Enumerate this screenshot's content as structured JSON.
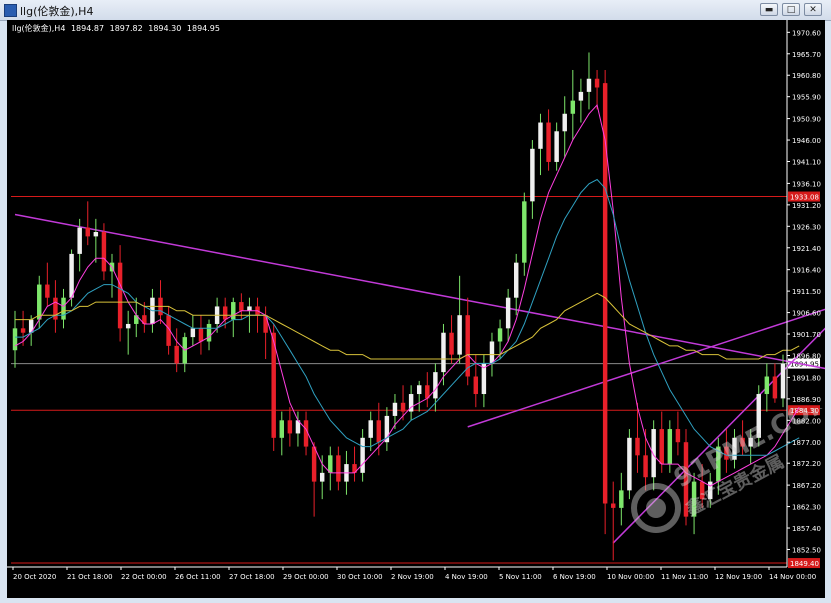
{
  "window": {
    "title": "llg(伦敦金),H4",
    "buttons": {
      "minimize": "▬",
      "maximize": "□",
      "close": "✕"
    }
  },
  "chart_data": {
    "type": "candlestick",
    "symbol_label": "llg(伦敦金),H4",
    "ohlc_header": {
      "open": "1894.87",
      "high": "1897.82",
      "low": "1894.30",
      "close": "1894.95"
    },
    "ylim": [
      1848.5,
      1972.5
    ],
    "y_ticks": [
      "1970.60",
      "1965.70",
      "1960.80",
      "1955.90",
      "1950.90",
      "1946.00",
      "1941.10",
      "1936.10",
      "1931.20",
      "1926.30",
      "1921.40",
      "1916.40",
      "1911.50",
      "1906.60",
      "1901.70",
      "1896.80",
      "1891.80",
      "1886.90",
      "1882.00",
      "1877.00",
      "1872.20",
      "1867.20",
      "1862.30",
      "1857.40",
      "1852.50"
    ],
    "x_ticks": [
      "20 Oct 2020",
      "21 Oct 18:00",
      "22 Oct 00:00",
      "26 Oct 11:00",
      "27 Oct 18:00",
      "29 Oct 00:00",
      "30 Oct 10:00",
      "2 Nov 19:00",
      "4 Nov 19:00",
      "5 Nov 11:00",
      "6 Nov 19:00",
      "10 Nov 00:00",
      "11 Nov 11:00",
      "12 Nov 19:00",
      "14 Nov 00:00"
    ],
    "current_price": "1894.95",
    "horizontal_lines": [
      {
        "value": 1933.1,
        "label": "1933.08",
        "color": "#d61a1a"
      },
      {
        "value": 1884.3,
        "label": "1884.30",
        "color": "#d61a1a"
      },
      {
        "value": 1849.4,
        "label": "1849.40",
        "color": "#d61a1a"
      }
    ],
    "bull_color": "#f0f0f0",
    "bull_color_alt": "#7ee66b",
    "bear_color": "#e8202a",
    "candles": [
      {
        "o": 1898,
        "h": 1907,
        "l": 1894,
        "c": 1903
      },
      {
        "o": 1903,
        "h": 1907,
        "l": 1899,
        "c": 1902
      },
      {
        "o": 1902,
        "h": 1906,
        "l": 1899,
        "c": 1905
      },
      {
        "o": 1905,
        "h": 1915,
        "l": 1903,
        "c": 1913
      },
      {
        "o": 1913,
        "h": 1918,
        "l": 1908,
        "c": 1910
      },
      {
        "o": 1910,
        "h": 1914,
        "l": 1902,
        "c": 1905
      },
      {
        "o": 1905,
        "h": 1912,
        "l": 1903,
        "c": 1910
      },
      {
        "o": 1910,
        "h": 1921,
        "l": 1908,
        "c": 1920
      },
      {
        "o": 1920,
        "h": 1928,
        "l": 1916,
        "c": 1926
      },
      {
        "o": 1926,
        "h": 1932,
        "l": 1922,
        "c": 1924
      },
      {
        "o": 1924,
        "h": 1928,
        "l": 1918,
        "c": 1925
      },
      {
        "o": 1925,
        "h": 1927,
        "l": 1914,
        "c": 1916
      },
      {
        "o": 1916,
        "h": 1920,
        "l": 1910,
        "c": 1918
      },
      {
        "o": 1918,
        "h": 1922,
        "l": 1900,
        "c": 1903
      },
      {
        "o": 1903,
        "h": 1907,
        "l": 1897,
        "c": 1904
      },
      {
        "o": 1904,
        "h": 1910,
        "l": 1901,
        "c": 1906
      },
      {
        "o": 1906,
        "h": 1909,
        "l": 1902,
        "c": 1904
      },
      {
        "o": 1904,
        "h": 1912,
        "l": 1902,
        "c": 1910
      },
      {
        "o": 1910,
        "h": 1914,
        "l": 1904,
        "c": 1906
      },
      {
        "o": 1906,
        "h": 1908,
        "l": 1897,
        "c": 1899
      },
      {
        "o": 1899,
        "h": 1903,
        "l": 1893,
        "c": 1895
      },
      {
        "o": 1895,
        "h": 1902,
        "l": 1893,
        "c": 1901
      },
      {
        "o": 1901,
        "h": 1906,
        "l": 1899,
        "c": 1903
      },
      {
        "o": 1903,
        "h": 1906,
        "l": 1897,
        "c": 1900
      },
      {
        "o": 1900,
        "h": 1905,
        "l": 1898,
        "c": 1904
      },
      {
        "o": 1904,
        "h": 1910,
        "l": 1902,
        "c": 1908
      },
      {
        "o": 1908,
        "h": 1910,
        "l": 1903,
        "c": 1905
      },
      {
        "o": 1905,
        "h": 1910,
        "l": 1901,
        "c": 1909
      },
      {
        "o": 1909,
        "h": 1911,
        "l": 1905,
        "c": 1907
      },
      {
        "o": 1907,
        "h": 1910,
        "l": 1902,
        "c": 1908
      },
      {
        "o": 1908,
        "h": 1910,
        "l": 1902,
        "c": 1906
      },
      {
        "o": 1906,
        "h": 1908,
        "l": 1896,
        "c": 1902
      },
      {
        "o": 1902,
        "h": 1904,
        "l": 1875,
        "c": 1878
      },
      {
        "o": 1878,
        "h": 1884,
        "l": 1874,
        "c": 1882
      },
      {
        "o": 1882,
        "h": 1885,
        "l": 1876,
        "c": 1879
      },
      {
        "o": 1879,
        "h": 1884,
        "l": 1876,
        "c": 1882
      },
      {
        "o": 1882,
        "h": 1884,
        "l": 1874,
        "c": 1876
      },
      {
        "o": 1876,
        "h": 1877,
        "l": 1860,
        "c": 1868
      },
      {
        "o": 1868,
        "h": 1874,
        "l": 1864,
        "c": 1870
      },
      {
        "o": 1870,
        "h": 1876,
        "l": 1866,
        "c": 1874
      },
      {
        "o": 1874,
        "h": 1876,
        "l": 1866,
        "c": 1868
      },
      {
        "o": 1868,
        "h": 1875,
        "l": 1865,
        "c": 1872
      },
      {
        "o": 1872,
        "h": 1876,
        "l": 1868,
        "c": 1870
      },
      {
        "o": 1870,
        "h": 1880,
        "l": 1868,
        "c": 1878
      },
      {
        "o": 1878,
        "h": 1884,
        "l": 1875,
        "c": 1882
      },
      {
        "o": 1882,
        "h": 1886,
        "l": 1874,
        "c": 1877
      },
      {
        "o": 1877,
        "h": 1885,
        "l": 1875,
        "c": 1883
      },
      {
        "o": 1883,
        "h": 1888,
        "l": 1880,
        "c": 1886
      },
      {
        "o": 1886,
        "h": 1890,
        "l": 1882,
        "c": 1884
      },
      {
        "o": 1884,
        "h": 1890,
        "l": 1882,
        "c": 1888
      },
      {
        "o": 1888,
        "h": 1891,
        "l": 1884,
        "c": 1890
      },
      {
        "o": 1890,
        "h": 1893,
        "l": 1885,
        "c": 1887
      },
      {
        "o": 1887,
        "h": 1895,
        "l": 1884,
        "c": 1893
      },
      {
        "o": 1893,
        "h": 1904,
        "l": 1890,
        "c": 1902
      },
      {
        "o": 1902,
        "h": 1906,
        "l": 1895,
        "c": 1897
      },
      {
        "o": 1897,
        "h": 1915,
        "l": 1895,
        "c": 1906
      },
      {
        "o": 1906,
        "h": 1910,
        "l": 1890,
        "c": 1892
      },
      {
        "o": 1892,
        "h": 1897,
        "l": 1885,
        "c": 1888
      },
      {
        "o": 1888,
        "h": 1897,
        "l": 1885,
        "c": 1895
      },
      {
        "o": 1895,
        "h": 1902,
        "l": 1892,
        "c": 1900
      },
      {
        "o": 1900,
        "h": 1905,
        "l": 1896,
        "c": 1903
      },
      {
        "o": 1903,
        "h": 1912,
        "l": 1900,
        "c": 1910
      },
      {
        "o": 1910,
        "h": 1920,
        "l": 1906,
        "c": 1918
      },
      {
        "o": 1918,
        "h": 1934,
        "l": 1915,
        "c": 1932
      },
      {
        "o": 1932,
        "h": 1946,
        "l": 1928,
        "c": 1944
      },
      {
        "o": 1944,
        "h": 1952,
        "l": 1938,
        "c": 1950
      },
      {
        "o": 1950,
        "h": 1953,
        "l": 1939,
        "c": 1941
      },
      {
        "o": 1941,
        "h": 1950,
        "l": 1939,
        "c": 1948
      },
      {
        "o": 1948,
        "h": 1956,
        "l": 1942,
        "c": 1952
      },
      {
        "o": 1952,
        "h": 1962,
        "l": 1946,
        "c": 1955
      },
      {
        "o": 1955,
        "h": 1960,
        "l": 1950,
        "c": 1957
      },
      {
        "o": 1957,
        "h": 1966,
        "l": 1953,
        "c": 1960
      },
      {
        "o": 1960,
        "h": 1962,
        "l": 1953,
        "c": 1958
      },
      {
        "o": 1959,
        "h": 1962,
        "l": 1856,
        "c": 1863
      },
      {
        "o": 1863,
        "h": 1868,
        "l": 1850,
        "c": 1862
      },
      {
        "o": 1862,
        "h": 1870,
        "l": 1858,
        "c": 1866
      },
      {
        "o": 1866,
        "h": 1880,
        "l": 1864,
        "c": 1878
      },
      {
        "o": 1878,
        "h": 1886,
        "l": 1870,
        "c": 1874
      },
      {
        "o": 1874,
        "h": 1880,
        "l": 1866,
        "c": 1869
      },
      {
        "o": 1869,
        "h": 1882,
        "l": 1866,
        "c": 1880
      },
      {
        "o": 1880,
        "h": 1884,
        "l": 1870,
        "c": 1872
      },
      {
        "o": 1872,
        "h": 1882,
        "l": 1870,
        "c": 1880
      },
      {
        "o": 1880,
        "h": 1884,
        "l": 1874,
        "c": 1877
      },
      {
        "o": 1877,
        "h": 1880,
        "l": 1858,
        "c": 1860
      },
      {
        "o": 1860,
        "h": 1870,
        "l": 1856,
        "c": 1868
      },
      {
        "o": 1868,
        "h": 1872,
        "l": 1862,
        "c": 1864
      },
      {
        "o": 1864,
        "h": 1870,
        "l": 1862,
        "c": 1868
      },
      {
        "o": 1868,
        "h": 1878,
        "l": 1865,
        "c": 1876
      },
      {
        "o": 1876,
        "h": 1880,
        "l": 1870,
        "c": 1873
      },
      {
        "o": 1873,
        "h": 1880,
        "l": 1871,
        "c": 1878
      },
      {
        "o": 1878,
        "h": 1882,
        "l": 1874,
        "c": 1876
      },
      {
        "o": 1876,
        "h": 1880,
        "l": 1872,
        "c": 1878
      },
      {
        "o": 1878,
        "h": 1890,
        "l": 1876,
        "c": 1888
      },
      {
        "o": 1888,
        "h": 1895,
        "l": 1884,
        "c": 1892
      },
      {
        "o": 1892,
        "h": 1895,
        "l": 1886,
        "c": 1887
      },
      {
        "o": 1887,
        "h": 1897,
        "l": 1885,
        "c": 1894.95
      }
    ],
    "moving_averages": [
      {
        "name": "MA-fast",
        "color": "#ff3fe0",
        "values": [
          1899,
          1900,
          1902,
          1905,
          1908,
          1909,
          1908,
          1910,
          1914,
          1917,
          1919,
          1919,
          1917,
          1913,
          1909,
          1906,
          1904,
          1904,
          1905,
          1903,
          1900,
          1898,
          1899,
          1900,
          1901,
          1903,
          1905,
          1906,
          1907,
          1907,
          1907,
          1906,
          1900,
          1893,
          1886,
          1882,
          1880,
          1876,
          1872,
          1870,
          1870,
          1870,
          1870,
          1872,
          1874,
          1876,
          1878,
          1881,
          1883,
          1885,
          1886,
          1887,
          1889,
          1892,
          1894,
          1896,
          1897,
          1895,
          1894,
          1895,
          1897,
          1900,
          1905,
          1912,
          1920,
          1928,
          1934,
          1938,
          1942,
          1946,
          1949,
          1952,
          1954,
          1946,
          1930,
          1910,
          1895,
          1885,
          1878,
          1874,
          1872,
          1872,
          1872,
          1870,
          1869,
          1868,
          1867,
          1868,
          1869,
          1870,
          1871,
          1872,
          1873,
          1874,
          1876,
          1879,
          1882,
          1885
        ]
      },
      {
        "name": "MA-mid",
        "color": "#2fa0c0",
        "values": [
          1901,
          1901,
          1902,
          1903,
          1905,
          1906,
          1906,
          1907,
          1909,
          1911,
          1912,
          1913,
          1913,
          1912,
          1911,
          1909,
          1908,
          1907,
          1907,
          1906,
          1905,
          1904,
          1903,
          1903,
          1903,
          1903,
          1904,
          1905,
          1905,
          1906,
          1906,
          1906,
          1904,
          1901,
          1898,
          1895,
          1892,
          1888,
          1885,
          1882,
          1880,
          1878,
          1877,
          1876,
          1876,
          1877,
          1878,
          1879,
          1880,
          1882,
          1883,
          1884,
          1886,
          1888,
          1890,
          1892,
          1894,
          1895,
          1895,
          1895,
          1896,
          1898,
          1900,
          1904,
          1909,
          1914,
          1919,
          1924,
          1928,
          1931,
          1934,
          1936,
          1937,
          1935,
          1929,
          1921,
          1914,
          1908,
          1902,
          1897,
          1893,
          1889,
          1886,
          1883,
          1880,
          1878,
          1876,
          1875,
          1874,
          1874,
          1874,
          1874,
          1874,
          1874,
          1875,
          1876,
          1877,
          1878
        ]
      },
      {
        "name": "MA-slow",
        "color": "#d8c23a",
        "values": [
          1905,
          1905,
          1905,
          1906,
          1906,
          1906,
          1907,
          1907,
          1908,
          1908,
          1909,
          1909,
          1909,
          1909,
          1909,
          1909,
          1908,
          1908,
          1908,
          1908,
          1907,
          1907,
          1906,
          1906,
          1906,
          1906,
          1906,
          1906,
          1906,
          1906,
          1906,
          1906,
          1905,
          1904,
          1903,
          1902,
          1901,
          1900,
          1899,
          1898,
          1898,
          1897,
          1897,
          1897,
          1896,
          1896,
          1896,
          1896,
          1896,
          1896,
          1896,
          1896,
          1896,
          1896,
          1896,
          1896,
          1897,
          1897,
          1897,
          1897,
          1897,
          1898,
          1899,
          1900,
          1901,
          1903,
          1904,
          1905,
          1907,
          1908,
          1909,
          1910,
          1911,
          1910,
          1908,
          1906,
          1904,
          1903,
          1902,
          1901,
          1900,
          1899,
          1899,
          1898,
          1898,
          1897,
          1897,
          1897,
          1896,
          1896,
          1896,
          1896,
          1896,
          1897,
          1897,
          1898,
          1898,
          1899
        ]
      }
    ],
    "trendlines": [
      {
        "color": "#c23ad8",
        "from": [
          0,
          1929.0
        ],
        "to": [
          112,
          1889.7
        ]
      },
      {
        "color": "#c23ad8",
        "from": [
          56,
          1880.5
        ],
        "to": [
          112,
          1914.5
        ]
      },
      {
        "color": "#c23ad8",
        "from": [
          74,
          1854.0
        ],
        "to": [
          112,
          1925.0
        ]
      }
    ]
  }
}
